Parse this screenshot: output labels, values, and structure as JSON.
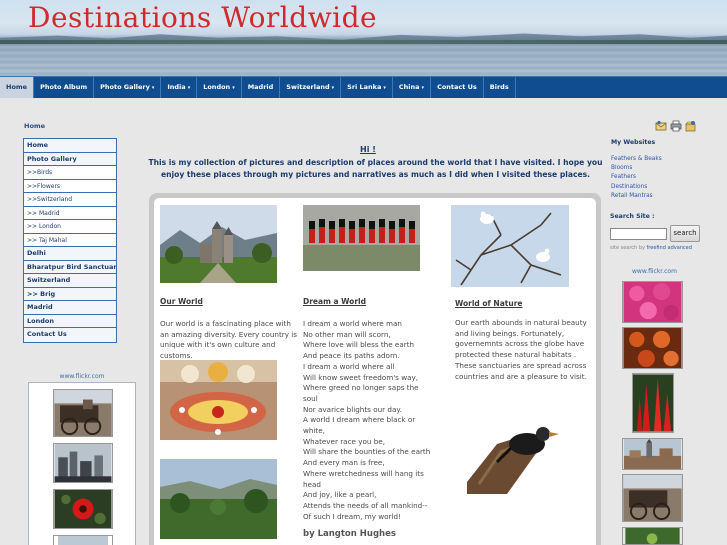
{
  "site": {
    "title": "Destinations Worldwide"
  },
  "nav": {
    "items": [
      {
        "label": "Home",
        "dropdown": false,
        "active": true
      },
      {
        "label": "Photo Album",
        "dropdown": false
      },
      {
        "label": "Photo Gallery",
        "dropdown": true
      },
      {
        "label": "India",
        "dropdown": true
      },
      {
        "label": "London",
        "dropdown": true
      },
      {
        "label": "Madrid",
        "dropdown": false
      },
      {
        "label": "Switzerland",
        "dropdown": true
      },
      {
        "label": "Sri Lanka",
        "dropdown": true
      },
      {
        "label": "China",
        "dropdown": true
      },
      {
        "label": "Contact Us",
        "dropdown": false
      },
      {
        "label": "Birds",
        "dropdown": false
      }
    ],
    "caret": "▾"
  },
  "breadcrumb": "Home",
  "leftmenu": {
    "items": [
      {
        "label": "Home",
        "sub": false
      },
      {
        "label": "Photo Gallery",
        "sub": false
      },
      {
        "label": ">>Birds",
        "sub": true
      },
      {
        "label": ">>Flowers",
        "sub": true
      },
      {
        "label": ">>Switzerland",
        "sub": true
      },
      {
        "label": ">> Madrid",
        "sub": true
      },
      {
        "label": ">> London",
        "sub": true
      },
      {
        "label": ">> Taj Mahal",
        "sub": true
      },
      {
        "label": "Delhi",
        "sub": false
      },
      {
        "label": "Bharatpur Bird Sanctuary",
        "sub": false
      },
      {
        "label": "Switzerland",
        "sub": false
      },
      {
        "label": ">> Brig",
        "sub": false
      },
      {
        "label": "Madrid",
        "sub": false
      },
      {
        "label": "London",
        "sub": false
      },
      {
        "label": "Contact Us",
        "sub": false
      }
    ]
  },
  "flickr": {
    "label": "www.flickr.com"
  },
  "intro": {
    "greeting": "Hi !",
    "text": "This is my collection of pictures and description of places around the world that I have visited. I hope you enjoy these places through my pictures and narratives as much as I did when I visited these places."
  },
  "columns": {
    "world": {
      "title": "Our World",
      "text": "Our world is a fascinating place with an amazing diversity. Every country is unique with it's own culture and customs."
    },
    "dream": {
      "title": "Dream a World ",
      "lines": [
        "I dream a world where man",
        "No other man will scorn,",
        "Where love will bless the earth",
        "And peace its paths adorn.",
        "I dream a world where all",
        "Will know sweet freedom's way,",
        "Where greed no longer saps the",
        "soul",
        "Nor avarice blights our day.",
        "A world I dream where black or",
        "white,",
        "Whatever race you be,",
        "Will share the bounties of the earth",
        "And every man is free,",
        "Where wretchedness will hang its",
        "head",
        "And joy, like a pearl,",
        "Attends the needs of all mankind--",
        "Of such I dream, my world!"
      ],
      "author": "by Langton Hughes"
    },
    "nature": {
      "title": "World of Nature",
      "text": "Our earth abounds in natural beauty and living beings. Fortunately, governemnts across the globe have protected these natural habitats . These sanctuaries are spread across countries and are a pleasure to visit."
    }
  },
  "right": {
    "websites_heading": "My Websites",
    "links": [
      "Feathers & Beaks",
      "Blooms",
      "Feathers",
      "Destinations",
      "Retail Mantras"
    ],
    "search_heading": "Search Site :",
    "search_button": "search",
    "search_note_prefix": "site search by",
    "search_note_brand": "freefind",
    "search_note_adv": "advanced"
  },
  "colors": {
    "nav_bg": "#0f4d90",
    "title_red": "#d12a2a",
    "link_blue": "#2b56a8",
    "menu_border": "#3b6cb0"
  },
  "icons": [
    "email-icon",
    "print-icon",
    "bookmark-icon"
  ]
}
